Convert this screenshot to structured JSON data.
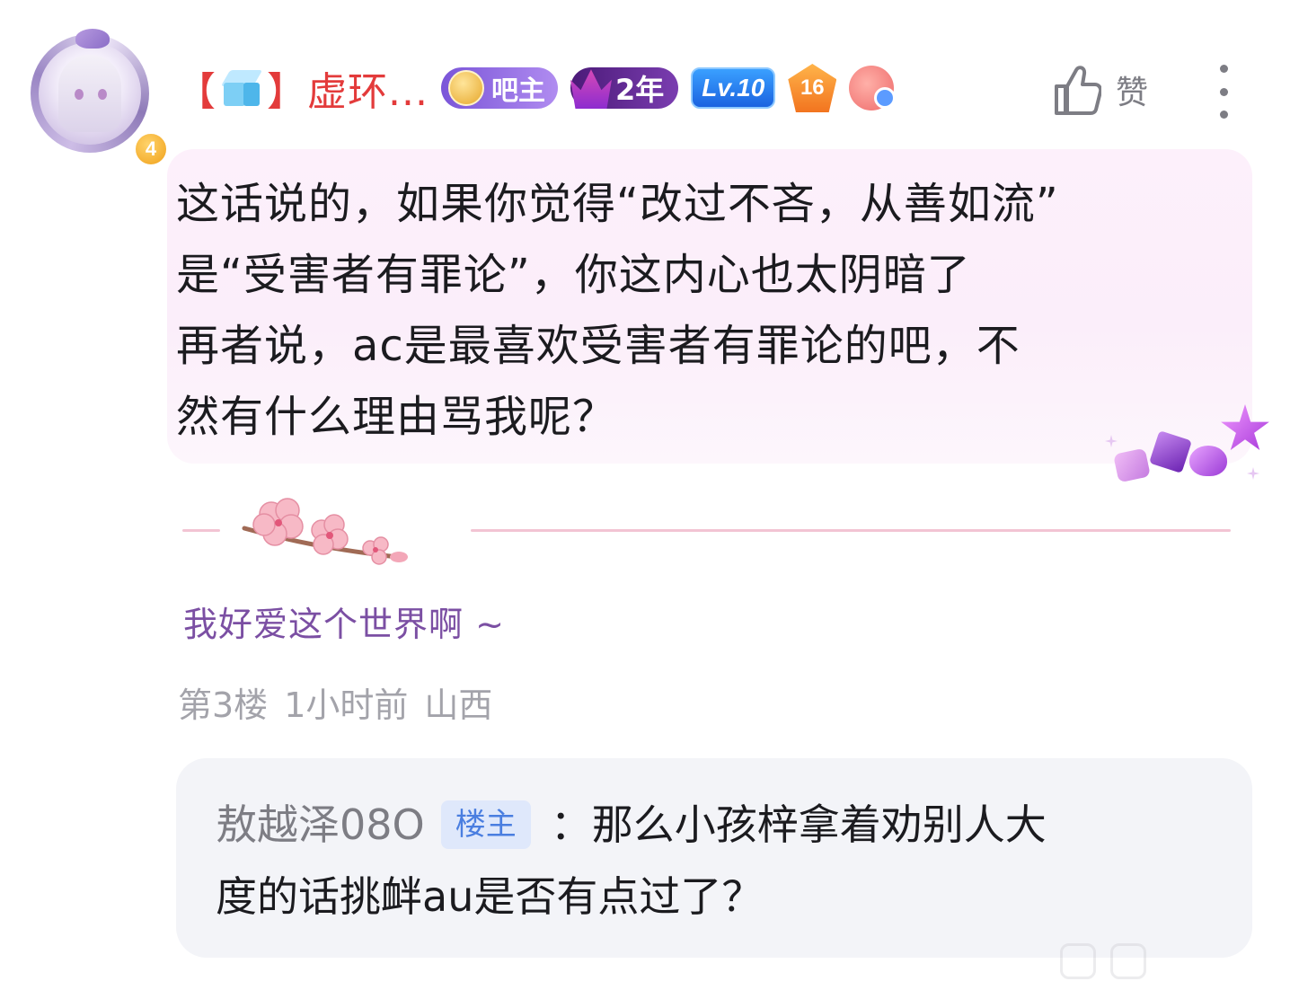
{
  "post": {
    "author": {
      "name_prefix": "【",
      "name_suffix": "】虚环...",
      "avatar_level": "4",
      "badges": {
        "bazhu": "吧主",
        "years": "2年",
        "level": "Lv.10",
        "number": "16"
      }
    },
    "like_label": "赞",
    "content_lines": [
      "这话说的，如果你觉得“改过不吝，从善如流”",
      "是“受害者有罪论”，你这内心也太阴暗了",
      "再者说，ac是最喜欢受害者有罪论的吧，不",
      "然有什么理由骂我呢？"
    ],
    "signature": "我好爱这个世界啊 ~",
    "meta": {
      "floor": "第3楼",
      "time": "1小时前",
      "location": "山西"
    }
  },
  "reply": {
    "user": "敖越泽08O",
    "tag": "楼主",
    "line1": "：那么小孩梓拿着劝别人大",
    "line2": "度的话挑衅au是否有点过了？"
  },
  "colors": {
    "username": "#e33b3b",
    "signature": "#7b4fa3",
    "meta": "#a3a3aa",
    "reply_tag_bg": "#dfe8fb",
    "reply_tag_text": "#4a7ee0",
    "bubble_bg": "#fbeefa"
  },
  "icons": [
    "ice-cube-icon",
    "thumbs-up-icon",
    "more-vertical-icon",
    "crown-icon",
    "medal-icon",
    "heart-emoji-icon",
    "gem-decoration",
    "cherry-blossom-decoration"
  ]
}
